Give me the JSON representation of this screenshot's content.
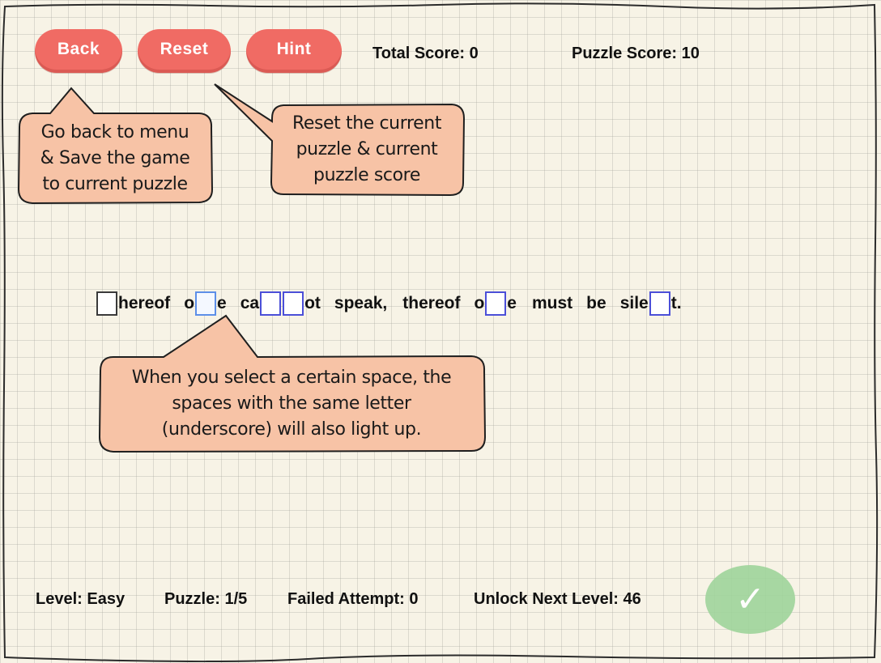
{
  "toolbar": {
    "back_label": "Back",
    "reset_label": "Reset",
    "hint_label": "Hint"
  },
  "scores": {
    "total": "Total Score: 0",
    "puzzle": "Puzzle Score: 10"
  },
  "callouts": {
    "back": [
      "Go back to menu",
      "& Save the game",
      "to current puzzle"
    ],
    "reset": [
      "Reset the current",
      "puzzle & current",
      "puzzle score"
    ],
    "space": [
      "When you select a certain space, the",
      "spaces with the same letter",
      "(underscore) will also light up."
    ]
  },
  "puzzle": {
    "fragments": [
      "hereof",
      "o",
      "e",
      "ca",
      "ot",
      "speak,",
      "thereof",
      "o",
      "e",
      "must",
      "be",
      "sile",
      "t."
    ]
  },
  "status": {
    "level": "Level: Easy",
    "puzzle": "Puzzle: 1/5",
    "failed": "Failed Attempt: 0",
    "unlock": "Unlock Next Level: 46"
  },
  "submit": {
    "icon": "checkmark-icon",
    "glyph": "✓"
  },
  "colors": {
    "button": "#f06b64",
    "callout_fill": "#f7c3a6",
    "slot_border": "#4b4fd8",
    "slot_active": "#5d8fe8",
    "submit": "#9fd49b",
    "paper": "#f7f3e6"
  }
}
